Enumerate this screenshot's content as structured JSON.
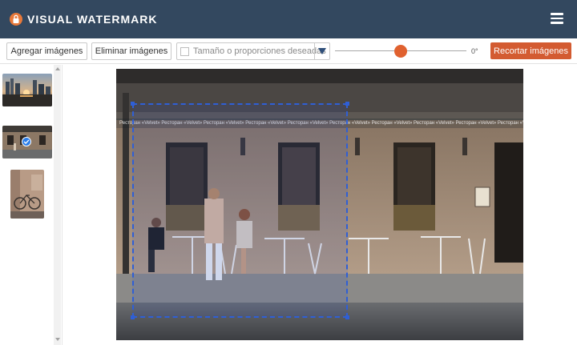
{
  "header": {
    "app_title": "VISUAL WATERMARK",
    "logo_icon": "lock-icon",
    "menu_icon": "hamburger-menu-icon",
    "background_color": "#33485f"
  },
  "toolbar": {
    "add_images_label": "Agregar imágenes",
    "remove_images_label": "Eliminar imágenes",
    "size_placeholder": "Tamaño o proporciones deseadas",
    "size_checked": false,
    "rotation_value": "0°",
    "crop_button_label": "Recortar imágenes",
    "accent_color": "#d35b31"
  },
  "sidebar": {
    "thumbnails": [
      {
        "name": "city-skyline-sunset",
        "selected": false
      },
      {
        "name": "cafe-street",
        "selected": true
      },
      {
        "name": "bicycle-wall",
        "selected": false
      }
    ]
  },
  "canvas": {
    "watermark_text": "Ресторан «Velvet» Ресторан «Velvet» Ресторан «Velvet» Ресторан «Velvet» Ресторан «Velvet» Ресторан «Velvet» Ресторан «Velvet» Ресторан «Velvet» Ресторан «Velvet» Ресторан «Velvet»",
    "crop_frame_color": "#2f5fd6"
  }
}
